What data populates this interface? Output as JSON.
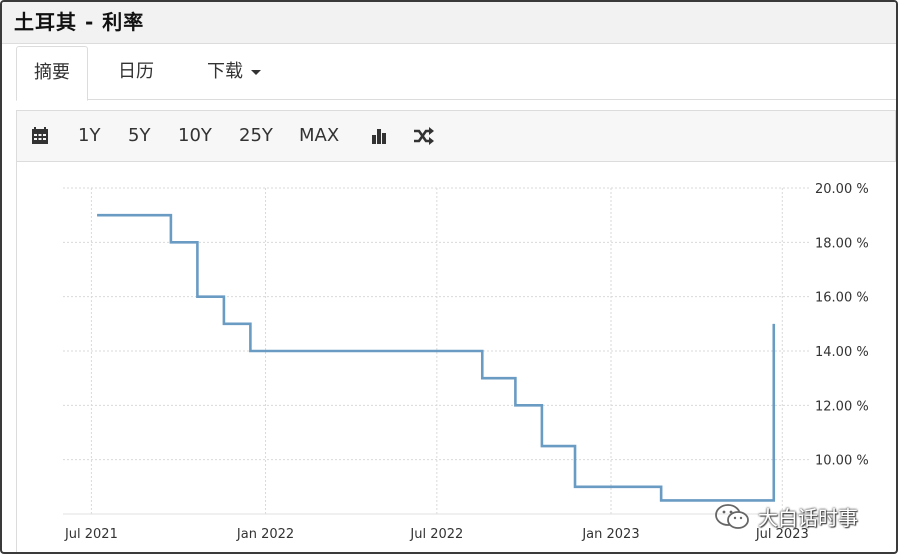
{
  "title": "土耳其 - 利率",
  "tabs": [
    {
      "label": "摘要",
      "active": true
    },
    {
      "label": "日历",
      "active": false
    },
    {
      "label": "下载",
      "active": false
    }
  ],
  "toolbar": {
    "calendar_icon": "calendar-icon",
    "ranges": [
      "1Y",
      "5Y",
      "10Y",
      "25Y",
      "MAX"
    ],
    "chart_type_icon": "bar-chart-icon",
    "compare_icon": "shuffle-icon"
  },
  "colors": {
    "line": "#6a9bc3",
    "grid": "#d9d9d9",
    "axis_text": "#333333"
  },
  "watermark": {
    "icon": "wechat-icon",
    "text": "大白话时事"
  },
  "chart_data": {
    "type": "line",
    "step": true,
    "x_ticks": [
      "Jul 2021",
      "Jan 2022",
      "Jul 2022",
      "Jan 2023",
      "Jul 2023"
    ],
    "y_ticks": [
      "20.00 %",
      "18.00 %",
      "16.00 %",
      "14.00 %",
      "12.00 %",
      "10.00 %"
    ],
    "ylim": [
      8,
      20
    ],
    "xlim": [
      "2021-06-01",
      "2023-07-25"
    ],
    "grid": true,
    "y_axis_side": "right",
    "series": [
      {
        "points": [
          {
            "x": "2021-07-07",
            "y": 19.0
          },
          {
            "x": "2021-09-23",
            "y": 18.0
          },
          {
            "x": "2021-10-21",
            "y": 16.0
          },
          {
            "x": "2021-11-18",
            "y": 15.0
          },
          {
            "x": "2021-12-16",
            "y": 14.0
          },
          {
            "x": "2022-08-18",
            "y": 13.0
          },
          {
            "x": "2022-09-22",
            "y": 12.0
          },
          {
            "x": "2022-10-20",
            "y": 10.5
          },
          {
            "x": "2022-11-24",
            "y": 9.0
          },
          {
            "x": "2023-02-23",
            "y": 8.5
          },
          {
            "x": "2023-06-22",
            "y": 15.0
          }
        ]
      }
    ]
  }
}
